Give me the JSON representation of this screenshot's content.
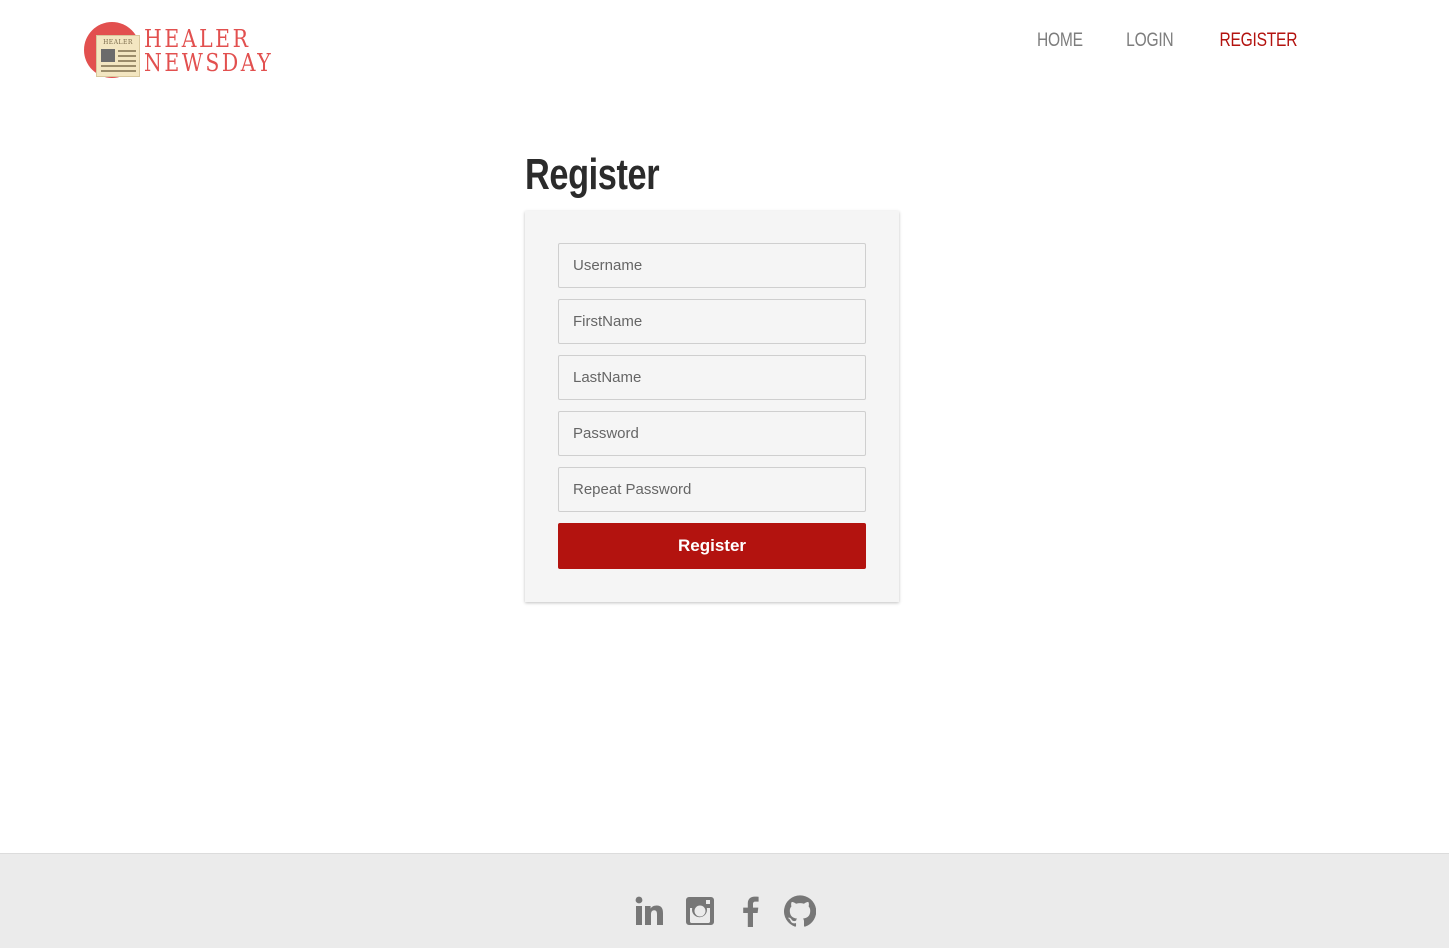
{
  "brand": {
    "line1": "HEALER",
    "line2": "NEWSDAY",
    "mini_masthead": "HEALER",
    "color": "#e2504f"
  },
  "nav": {
    "items": [
      {
        "label": "HOME",
        "active": false
      },
      {
        "label": "LOGIN",
        "active": false
      },
      {
        "label": "REGISTER",
        "active": true
      }
    ],
    "active_color": "#b3130f"
  },
  "page": {
    "title": "Register"
  },
  "form": {
    "fields": [
      {
        "name": "username",
        "placeholder": "Username",
        "value": ""
      },
      {
        "name": "firstname",
        "placeholder": "FirstName",
        "value": ""
      },
      {
        "name": "lastname",
        "placeholder": "LastName",
        "value": ""
      },
      {
        "name": "password",
        "placeholder": "Password",
        "value": ""
      },
      {
        "name": "repeat_password",
        "placeholder": "Repeat Password",
        "value": ""
      }
    ],
    "submit_label": "Register",
    "submit_color": "#b3130f"
  },
  "footer": {
    "social_icons": [
      "linkedin-icon",
      "instagram-icon",
      "facebook-icon",
      "github-icon"
    ]
  }
}
